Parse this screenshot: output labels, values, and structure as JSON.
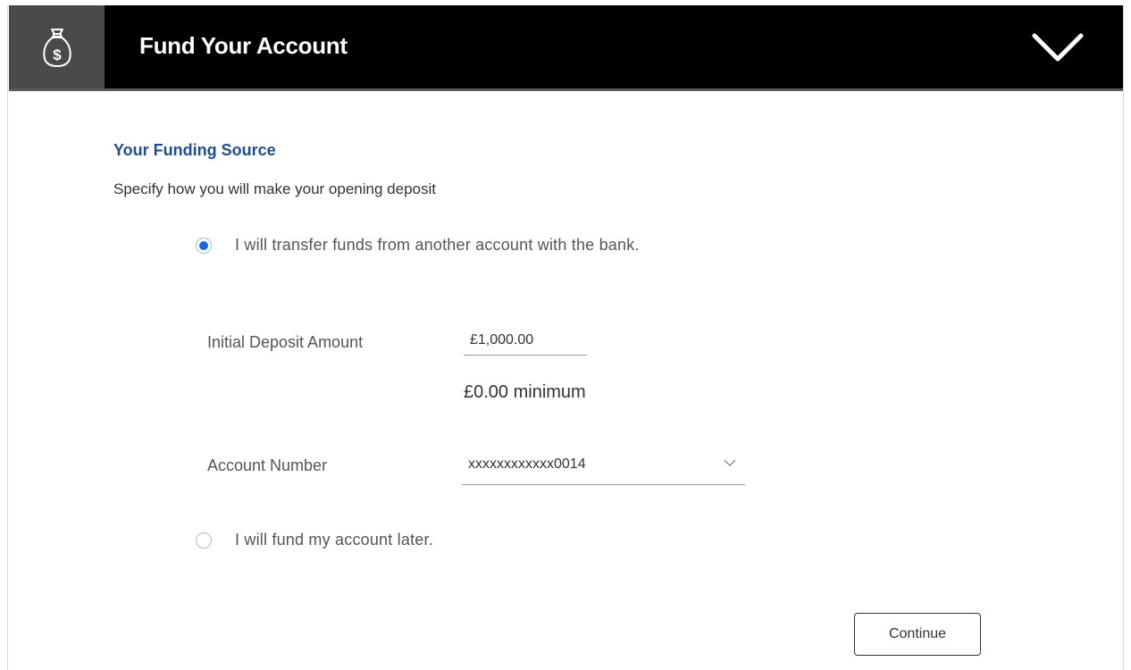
{
  "header": {
    "title": "Fund Your Account",
    "icon": "money-bag-icon",
    "toggle_icon": "chevron-down-icon"
  },
  "funding": {
    "section_title": "Your Funding Source",
    "description": "Specify how you will make your opening deposit",
    "option_transfer": {
      "label": "I will transfer funds from another account with the bank.",
      "selected": true
    },
    "option_later": {
      "label": "I will fund my account later.",
      "selected": false
    },
    "initial_deposit": {
      "label": "Initial Deposit Amount",
      "value": "£1,000.00",
      "minimum_note": "£0.00 minimum"
    },
    "account_number": {
      "label": "Account Number",
      "selected_value": "xxxxxxxxxxxx0014"
    }
  },
  "actions": {
    "continue_label": "Continue"
  },
  "colors": {
    "header_bg": "#000000",
    "accent_blue": "#1f4e8c",
    "radio_selected": "#1a66d9"
  }
}
